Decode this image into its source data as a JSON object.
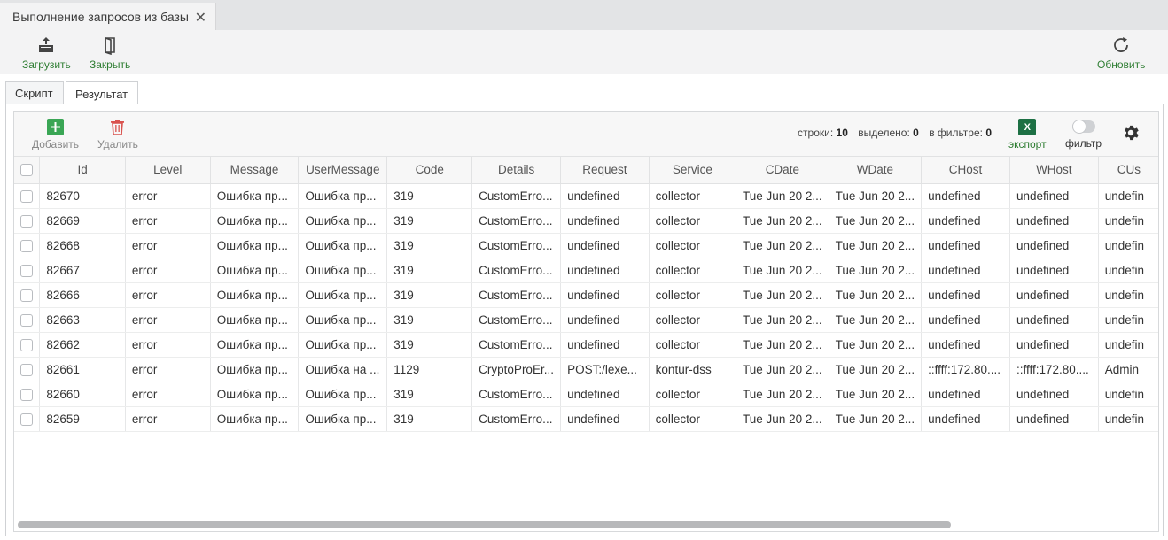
{
  "doc_tab": {
    "title": "Выполнение запросов из базы",
    "close_glyph": "✕"
  },
  "toolbar": {
    "load_label": "Загрузить",
    "close_label": "Закрыть",
    "refresh_label": "Обновить",
    "accent": "#2e7d32"
  },
  "result_tabs": [
    {
      "label": "Скрипт",
      "active": false
    },
    {
      "label": "Результат",
      "active": true
    }
  ],
  "grid_toolbar": {
    "add_label": "Добавить",
    "delete_label": "Удалить",
    "rows_label": "строки:",
    "rows_value": "10",
    "selected_label": "выделено:",
    "selected_value": "0",
    "filter_label": "в фильтре:",
    "filter_value": "0",
    "export_label": "экспорт",
    "export_icon_text": "X",
    "filter_toggle_label": "фильтр"
  },
  "columns": [
    "Id",
    "Level",
    "Message",
    "UserMessage",
    "Code",
    "Details",
    "Request",
    "Service",
    "CDate",
    "WDate",
    "CHost",
    "WHost",
    "CUs"
  ],
  "rows": [
    [
      "82670",
      "error",
      "Ошибка пр...",
      "Ошибка пр...",
      "319",
      "CustomErro...",
      "undefined",
      "collector",
      "Tue Jun 20 2...",
      "Tue Jun 20 2...",
      "undefined",
      "undefined",
      "undefin"
    ],
    [
      "82669",
      "error",
      "Ошибка пр...",
      "Ошибка пр...",
      "319",
      "CustomErro...",
      "undefined",
      "collector",
      "Tue Jun 20 2...",
      "Tue Jun 20 2...",
      "undefined",
      "undefined",
      "undefin"
    ],
    [
      "82668",
      "error",
      "Ошибка пр...",
      "Ошибка пр...",
      "319",
      "CustomErro...",
      "undefined",
      "collector",
      "Tue Jun 20 2...",
      "Tue Jun 20 2...",
      "undefined",
      "undefined",
      "undefin"
    ],
    [
      "82667",
      "error",
      "Ошибка пр...",
      "Ошибка пр...",
      "319",
      "CustomErro...",
      "undefined",
      "collector",
      "Tue Jun 20 2...",
      "Tue Jun 20 2...",
      "undefined",
      "undefined",
      "undefin"
    ],
    [
      "82666",
      "error",
      "Ошибка пр...",
      "Ошибка пр...",
      "319",
      "CustomErro...",
      "undefined",
      "collector",
      "Tue Jun 20 2...",
      "Tue Jun 20 2...",
      "undefined",
      "undefined",
      "undefin"
    ],
    [
      "82663",
      "error",
      "Ошибка пр...",
      "Ошибка пр...",
      "319",
      "CustomErro...",
      "undefined",
      "collector",
      "Tue Jun 20 2...",
      "Tue Jun 20 2...",
      "undefined",
      "undefined",
      "undefin"
    ],
    [
      "82662",
      "error",
      "Ошибка пр...",
      "Ошибка пр...",
      "319",
      "CustomErro...",
      "undefined",
      "collector",
      "Tue Jun 20 2...",
      "Tue Jun 20 2...",
      "undefined",
      "undefined",
      "undefin"
    ],
    [
      "82661",
      "error",
      "Ошибка пр...",
      "Ошибка на ...",
      "1129",
      "CryptoProEr...",
      "POST:/lexe...",
      "kontur-dss",
      "Tue Jun 20 2...",
      "Tue Jun 20 2...",
      "::ffff:172.80....",
      "::ffff:172.80....",
      "Admin"
    ],
    [
      "82660",
      "error",
      "Ошибка пр...",
      "Ошибка пр...",
      "319",
      "CustomErro...",
      "undefined",
      "collector",
      "Tue Jun 20 2...",
      "Tue Jun 20 2...",
      "undefined",
      "undefined",
      "undefin"
    ],
    [
      "82659",
      "error",
      "Ошибка пр...",
      "Ошибка пр...",
      "319",
      "CustomErro...",
      "undefined",
      "collector",
      "Tue Jun 20 2...",
      "Tue Jun 20 2...",
      "undefined",
      "undefined",
      "undefin"
    ]
  ],
  "icons": {
    "load": "upload-tray-icon",
    "close": "door-icon",
    "refresh": "refresh-icon",
    "add": "plus-square-icon",
    "delete": "trash-icon",
    "export": "excel-icon",
    "settings": "gear-icon"
  }
}
